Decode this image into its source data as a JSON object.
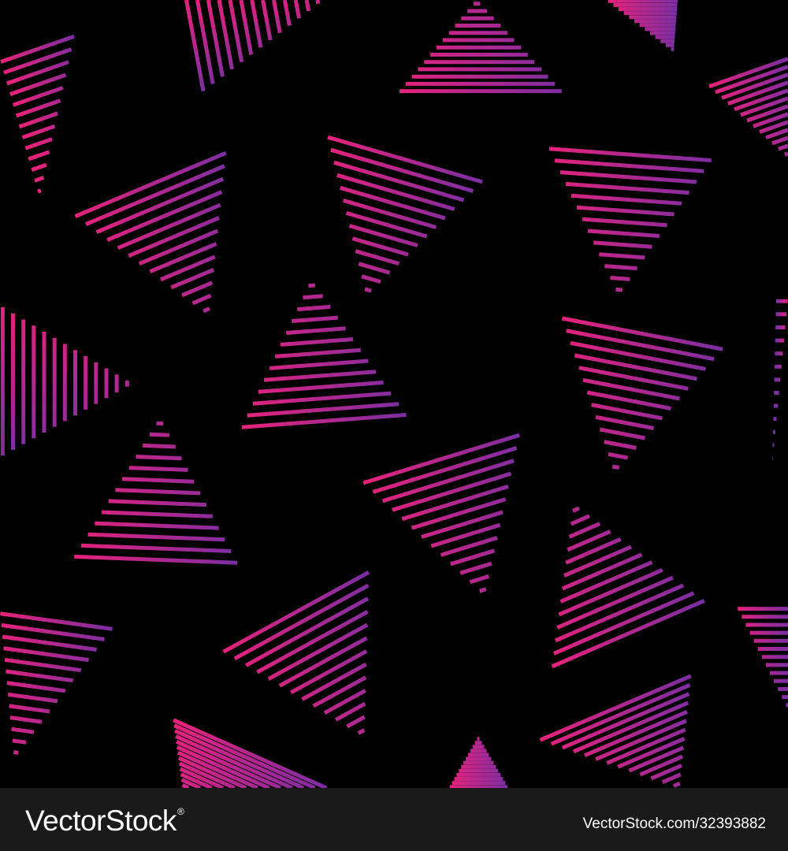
{
  "image": {
    "subject": "seamless pattern of striped triangles",
    "background_color": "#000000",
    "stripe_gradient": [
      "#e8227a",
      "#7a2ea3"
    ]
  },
  "footer": {
    "brand": "VectorStock",
    "brand_mark": "®",
    "image_id": "VectorStock.com/32393882",
    "background_color": "#1a1a1a",
    "text_color": "#ffffff"
  }
}
